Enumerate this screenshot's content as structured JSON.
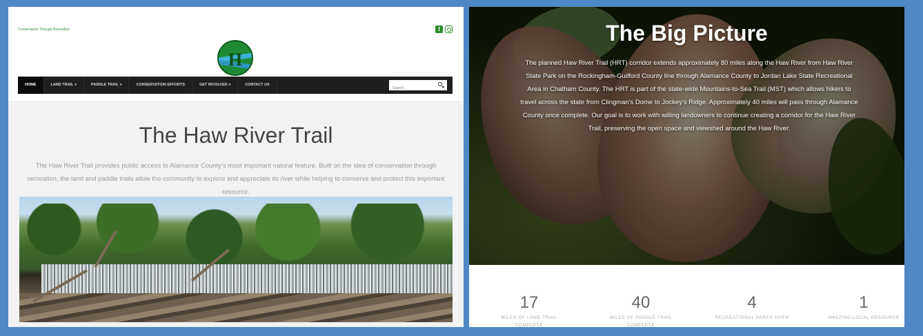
{
  "left_page": {
    "tagline": "Conservation Through Recreation",
    "social": {
      "facebook_glyph": "f"
    },
    "logo": {
      "letter": "H"
    },
    "nav": {
      "items": [
        {
          "label": "HOME",
          "caret": ""
        },
        {
          "label": "LAND TRAIL",
          "caret": "▾"
        },
        {
          "label": "PADDLE TRAIL",
          "caret": "▾"
        },
        {
          "label": "CONSERVATION EFFORTS",
          "caret": ""
        },
        {
          "label": "GET INVOLVED",
          "caret": "▾"
        },
        {
          "label": "CONTACT US",
          "caret": ""
        }
      ],
      "search_placeholder": "Search..."
    },
    "title": "The Haw River Trail",
    "description": "The Haw River Trail provides public access to Alamance County's most important natural feature. Built on the idea of conservation through recreation, the land and paddle trails allow the community to explore and appreciate its river while helping to conserve and protect this important resource."
  },
  "right_page": {
    "title": "The Big Picture",
    "text": "The planned Haw River Trail (HRT) corridor extends approximately 80 miles along the Haw River from Haw River State Park on the Rockingham-Guilford County line through Alamance County to Jordan Lake State Recreational Area in Chatham County. The HRT is part of the state-wide Mountains-to-Sea Trail (MST) which allows hikers to travel across the state from Clingman's Dome to Jockey's Ridge. Approximately 40 miles will pass through Alamance County once complete. Our goal is to work with willing landowners to continue creating a corridor for the Haw River Trail, preserving the open space and viewshed around the Haw River.",
    "stats": [
      {
        "value": "17",
        "label_line1": "MILES OF LAND TRAIL",
        "label_line2": "COMPLETE"
      },
      {
        "value": "40",
        "label_line1": "MILES OF PADDLE TRAIL",
        "label_line2": "COMPLETE"
      },
      {
        "value": "4",
        "label_line1": "RECREATIONAL PARKS OPEN",
        "label_line2": ""
      },
      {
        "value": "1",
        "label_line1": "AMAZING LOCAL RESOURCE",
        "label_line2": ""
      }
    ]
  },
  "colors": {
    "frame_border": "#4f88c6",
    "brand_green": "#2e8b2e",
    "nav_bg": "#1f1f1f",
    "text_gray": "#9a9a9a"
  },
  "icons": [
    "facebook-icon",
    "instagram-icon",
    "search-icon",
    "logo-icon"
  ]
}
